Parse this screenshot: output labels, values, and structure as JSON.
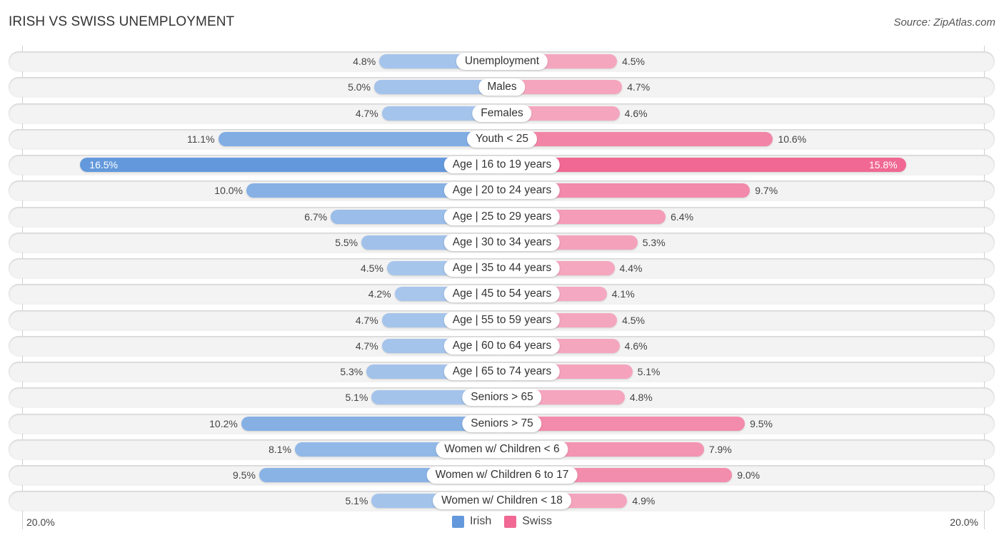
{
  "header": {
    "title": "IRISH VS SWISS UNEMPLOYMENT",
    "source": "Source: ZipAtlas.com"
  },
  "colors": {
    "irish_strong": "#6399dc",
    "irish_light": "#a9c7ec",
    "swiss_strong": "#f06893",
    "swiss_light": "#f5a9c1"
  },
  "chart_data": {
    "type": "bar",
    "orientation": "horizontal-diverging",
    "title": "IRISH VS SWISS UNEMPLOYMENT",
    "xlabel": "",
    "ylabel": "",
    "xlim": [
      -20,
      20
    ],
    "axis_tick_labels": [
      "20.0%",
      "20.0%"
    ],
    "legend_position": "bottom-center",
    "categories": [
      "Unemployment",
      "Males",
      "Females",
      "Youth < 25",
      "Age | 16 to 19 years",
      "Age | 20 to 24 years",
      "Age | 25 to 29 years",
      "Age | 30 to 34 years",
      "Age | 35 to 44 years",
      "Age | 45 to 54 years",
      "Age | 55 to 59 years",
      "Age | 60 to 64 years",
      "Age | 65 to 74 years",
      "Seniors > 65",
      "Seniors > 75",
      "Women w/ Children < 6",
      "Women w/ Children 6 to 17",
      "Women w/ Children < 18"
    ],
    "series": [
      {
        "name": "Irish",
        "side": "left",
        "values": [
          4.8,
          5.0,
          4.7,
          11.1,
          16.5,
          10.0,
          6.7,
          5.5,
          4.5,
          4.2,
          4.7,
          4.7,
          5.3,
          5.1,
          10.2,
          8.1,
          9.5,
          5.1
        ],
        "labels": [
          "4.8%",
          "5.0%",
          "4.7%",
          "11.1%",
          "16.5%",
          "10.0%",
          "6.7%",
          "5.5%",
          "4.5%",
          "4.2%",
          "4.7%",
          "4.7%",
          "5.3%",
          "5.1%",
          "10.2%",
          "8.1%",
          "9.5%",
          "5.1%"
        ]
      },
      {
        "name": "Swiss",
        "side": "right",
        "values": [
          4.5,
          4.7,
          4.6,
          10.6,
          15.8,
          9.7,
          6.4,
          5.3,
          4.4,
          4.1,
          4.5,
          4.6,
          5.1,
          4.8,
          9.5,
          7.9,
          9.0,
          4.9
        ],
        "labels": [
          "4.5%",
          "4.7%",
          "4.6%",
          "10.6%",
          "15.8%",
          "9.7%",
          "6.4%",
          "5.3%",
          "4.4%",
          "4.1%",
          "4.5%",
          "4.6%",
          "5.1%",
          "4.8%",
          "9.5%",
          "7.9%",
          "9.0%",
          "4.9%"
        ]
      }
    ]
  },
  "legend": {
    "items": [
      {
        "name": "Irish",
        "color": "#6399dc"
      },
      {
        "name": "Swiss",
        "color": "#f06893"
      }
    ]
  },
  "axis": {
    "left_label": "20.0%",
    "right_label": "20.0%"
  }
}
